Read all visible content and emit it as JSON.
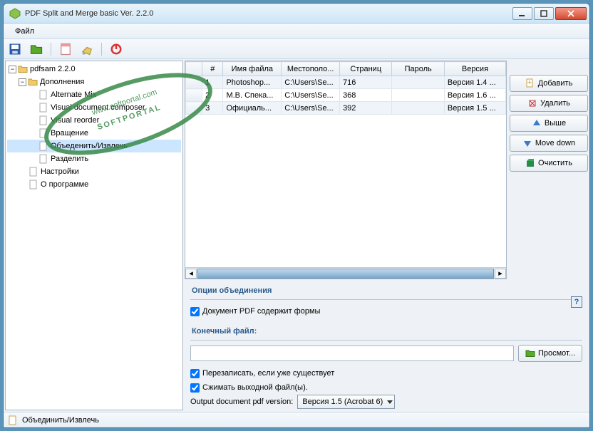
{
  "window": {
    "title": "PDF Split and Merge basic Ver. 2.2.0"
  },
  "menu": {
    "file": "Файл"
  },
  "tree": {
    "root": "pdfsam 2.2.0",
    "addons": "Дополнения",
    "items": [
      "Alternate Mix",
      "Visual document composer",
      "Visual reorder",
      "Вращение",
      "Объеденить/Извлечь",
      "Разделить"
    ],
    "settings": "Настройки",
    "about": "О программе"
  },
  "table": {
    "headers": {
      "num": "#",
      "name": "Имя файла",
      "loc": "Местополо...",
      "pages": "Страниц",
      "password": "Пароль",
      "version": "Версия"
    },
    "rows": [
      {
        "n": "1",
        "name": "Photoshop...",
        "loc": "C:\\Users\\Se...",
        "pages": "716",
        "pwd": "",
        "ver": "Версия 1.4 ..."
      },
      {
        "n": "2",
        "name": "М.В. Спека...",
        "loc": "C:\\Users\\Se...",
        "pages": "368",
        "pwd": "",
        "ver": "Версия 1.6 ..."
      },
      {
        "n": "3",
        "name": "Официаль...",
        "loc": "C:\\Users\\Se...",
        "pages": "392",
        "pwd": "",
        "ver": "Версия 1.5 ..."
      }
    ]
  },
  "buttons": {
    "add": "Добавить",
    "delete": "Удалить",
    "up": "Выше",
    "down": "Move down",
    "clear": "Очистить",
    "browse": "Просмот..."
  },
  "merge_section": {
    "title": "Опции объединения",
    "forms": "Документ PDF содержит формы"
  },
  "out_section": {
    "title": "Конечный файл:",
    "overwrite": "Перезаписать, если уже существует",
    "compress": "Сжимать выходной файл(ы).",
    "version_label": "Output document pdf version:",
    "version_value": "Версия 1.5 (Acrobat 6)"
  },
  "status": {
    "text": "Объединить/Извлечь"
  },
  "watermark": {
    "text": "SOFTPORTAL",
    "url": "www.softportal.com"
  }
}
